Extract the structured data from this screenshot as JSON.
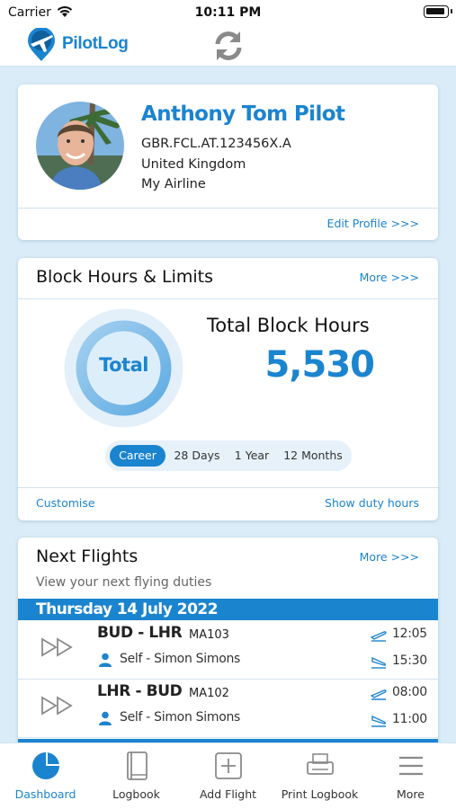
{
  "status_bar": {
    "carrier": "Carrier",
    "time": "10:11 PM"
  },
  "app_bar": {
    "app_name": "PilotLog"
  },
  "profile": {
    "name": "Anthony Tom Pilot",
    "license": "GBR.FCL.AT.123456X.A",
    "country": "United Kingdom",
    "airline": "My Airline",
    "edit_link": "Edit Profile >>>"
  },
  "block_hours": {
    "title": "Block Hours & Limits",
    "more_link": "More >>>",
    "donut_label": "Total",
    "total_label": "Total Block Hours",
    "total_value": "5,530",
    "periods": [
      "Career",
      "28 Days",
      "1 Year",
      "12 Months"
    ],
    "selected_period": "Career",
    "customise_link": "Customise",
    "duty_link": "Show duty hours"
  },
  "next_flights": {
    "title": "Next Flights",
    "more_link": "More >>>",
    "subtitle": "View your next flying duties",
    "date_header": "Thursday 14 July 2022",
    "flights": [
      {
        "route": "BUD - LHR",
        "flight_no": "MA103",
        "crew": "Self - Simon Simons",
        "departure": "12:05",
        "arrival": "15:30"
      },
      {
        "route": "LHR - BUD",
        "flight_no": "MA102",
        "crew": "Self - Simon Simons",
        "departure": "08:00",
        "arrival": "11:00"
      }
    ]
  },
  "tab_bar": {
    "tabs": [
      {
        "label": "Dashboard",
        "icon": "pie-chart-icon",
        "active": true
      },
      {
        "label": "Logbook",
        "icon": "book-icon",
        "active": false
      },
      {
        "label": "Add Flight",
        "icon": "plus-square-icon",
        "active": false
      },
      {
        "label": "Print Logbook",
        "icon": "printer-icon",
        "active": false
      },
      {
        "label": "More",
        "icon": "menu-icon",
        "active": false
      }
    ]
  },
  "colors": {
    "accent": "#1b84cf",
    "background": "#d9ecf7"
  }
}
